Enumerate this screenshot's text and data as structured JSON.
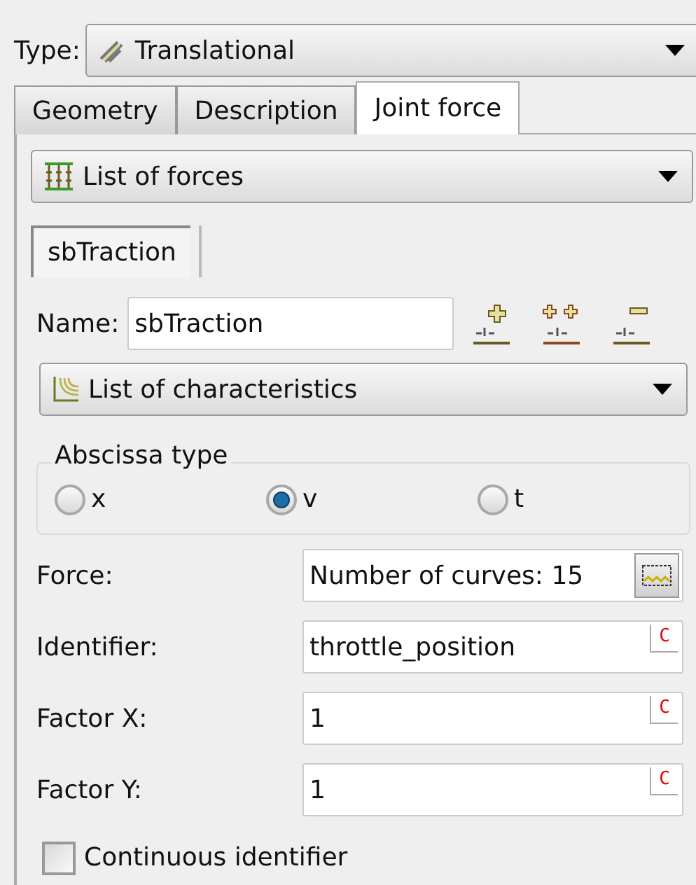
{
  "type_select": {
    "label": "Type:",
    "value": "Translational"
  },
  "tabs": [
    {
      "label": "Geometry",
      "selected": false
    },
    {
      "label": "Description",
      "selected": false
    },
    {
      "label": "Joint force",
      "selected": true
    }
  ],
  "forces_select": {
    "value": "List of forces"
  },
  "force_tabs": [
    {
      "label": "sbTraction",
      "selected": true
    }
  ],
  "name_field": {
    "label": "Name:",
    "value": "sbTraction"
  },
  "characteristics_select": {
    "value": "List of characteristics"
  },
  "abscissa_type": {
    "title": "Abscissa type",
    "options": [
      {
        "label": "x",
        "selected": false
      },
      {
        "label": "v",
        "selected": true
      },
      {
        "label": "t",
        "selected": false
      }
    ]
  },
  "fields": [
    {
      "kind": "curves",
      "label": "Force:",
      "value": "Number of curves: 15"
    },
    {
      "kind": "text",
      "label": "Identifier:",
      "value": "throttle_position",
      "marker": "C"
    },
    {
      "kind": "text",
      "label": "Factor X:",
      "value": "1",
      "marker": "C"
    },
    {
      "kind": "text",
      "label": "Factor Y:",
      "value": "1",
      "marker": "C"
    }
  ],
  "continuous_identifier": {
    "label": "Continuous identifier",
    "checked": false
  }
}
